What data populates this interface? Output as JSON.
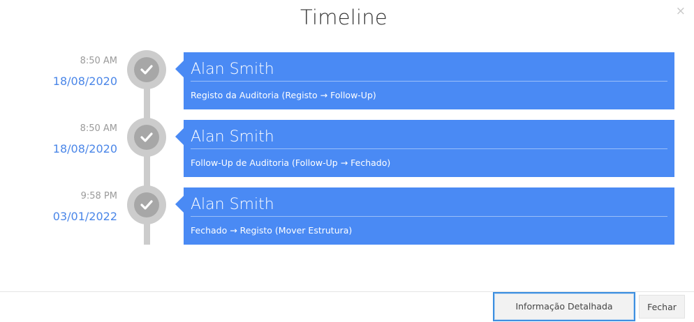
{
  "modal": {
    "title": "Timeline",
    "close_symbol": "×"
  },
  "entries": [
    {
      "time": "8:50 AM",
      "date": "18/08/2020",
      "user": "Alan Smith",
      "description": "Registo da Auditoria (Registo → Follow-Up)",
      "icon": "check-icon"
    },
    {
      "time": "8:50 AM",
      "date": "18/08/2020",
      "user": "Alan Smith",
      "description": "Follow-Up de Auditoria (Follow-Up → Fechado)",
      "icon": "check-icon"
    },
    {
      "time": "9:58 PM",
      "date": "03/01/2022",
      "user": "Alan Smith",
      "description": "Fechado → Registo (Mover Estrutura)",
      "icon": "check-icon"
    }
  ],
  "footer": {
    "detail_label": "Informação Detalhada",
    "close_label": "Fechar"
  },
  "colors": {
    "card_background": "#4a8af4",
    "date_text": "#4a86e8",
    "timeline_gray": "#cccccc",
    "focus_border": "#3d8fe0"
  }
}
